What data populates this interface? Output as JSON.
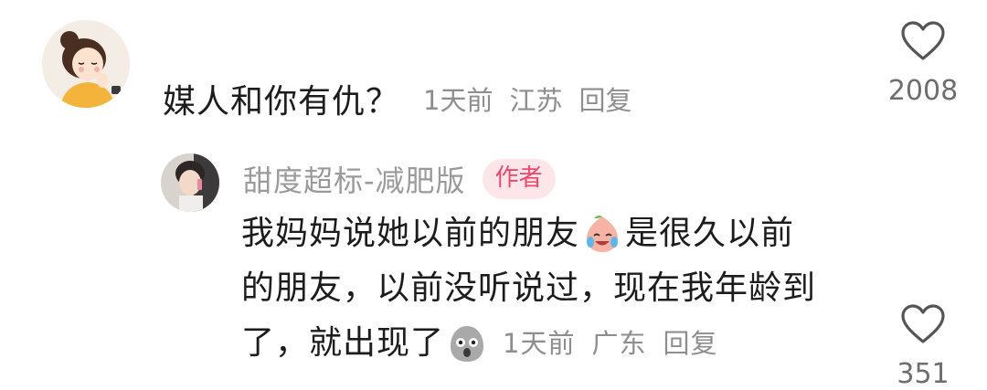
{
  "comment": {
    "text": "媒人和你有仇？",
    "time": "1天前",
    "location": "江苏",
    "reply_label": "回复",
    "likes": "2008"
  },
  "reply": {
    "username": "甜度超标-减肥版",
    "badge": "作者",
    "text_line1_a": "我妈妈说她以前的朋友",
    "emoji1": "crying-laughing-peach-emoji",
    "text_line1_b": "是很久以前",
    "text_line2": "的朋友，以前没听说过，现在我年龄到",
    "text_line3": "了，就出现了",
    "emoji2": "shocked-blob-emoji",
    "time": "1天前",
    "location": "广东",
    "reply_label": "回复",
    "likes": "351"
  },
  "icons": {
    "like": "heart-outline-icon"
  },
  "colors": {
    "author_badge_bg": "#fde6ea",
    "author_badge_text": "#f0466a",
    "meta_gray": "#8e8e8e"
  }
}
